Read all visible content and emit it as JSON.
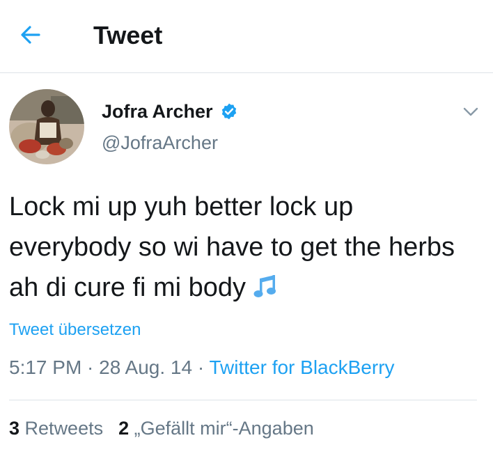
{
  "header": {
    "title": "Tweet"
  },
  "author": {
    "name": "Jofra Archer",
    "handle": "@JofraArcher"
  },
  "tweet": {
    "text": "Lock mi up yuh better lock up everybody so wi have to get the herbs ah di cure fi mi body",
    "emoji": "musical-notes"
  },
  "translate_label": "Tweet übersetzen",
  "meta": {
    "time": "5:17 PM",
    "sep1": " · ",
    "date": "28 Aug. 14",
    "sep2": " · ",
    "source": "Twitter for BlackBerry"
  },
  "stats": {
    "retweets_count": "3",
    "retweets_label": "Retweets",
    "likes_count": "2",
    "likes_label": "„Gefällt mir“-Angaben"
  },
  "colors": {
    "accent": "#1da1f2",
    "secondary_text": "#657786",
    "divider": "#dde3e8"
  }
}
